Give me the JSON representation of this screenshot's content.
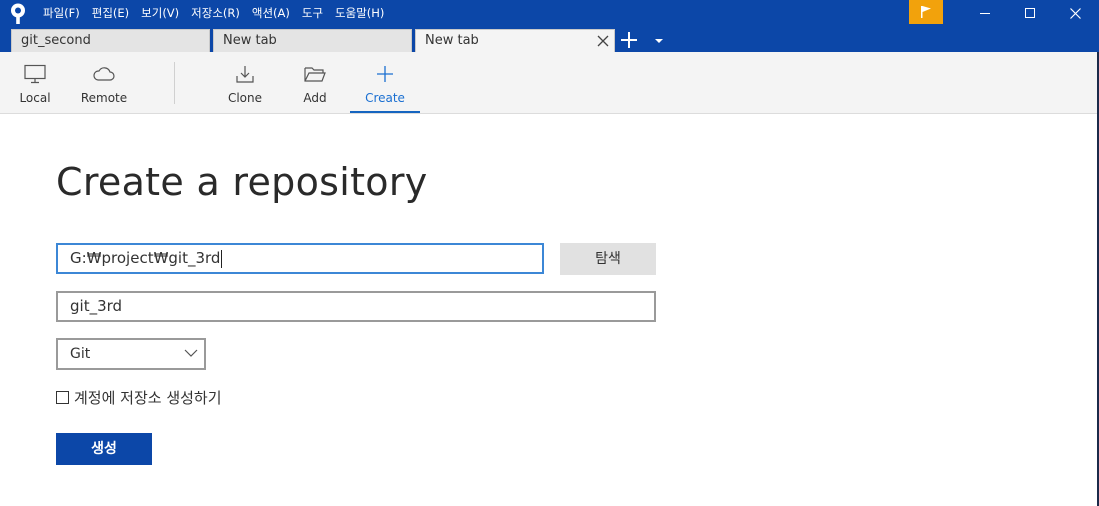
{
  "app": {
    "menu": [
      "파일(F)",
      "편집(E)",
      "보기(V)",
      "저장소(R)",
      "액션(A)",
      "도구",
      "도움말(H)"
    ],
    "colors": {
      "titlebar": "#0c47a8",
      "accent": "#1565c0",
      "flag": "#f2a20c"
    },
    "icons": {
      "logo": "sourcetree-logo-icon",
      "flag": "flag-icon",
      "minimize": "minimize-icon",
      "maximize": "maximize-icon",
      "close": "close-icon"
    }
  },
  "tabs": [
    {
      "label": "git_second",
      "active": false
    },
    {
      "label": "New tab",
      "active": false
    },
    {
      "label": "New tab",
      "active": true
    }
  ],
  "toolbar": {
    "local": "Local",
    "remote": "Remote",
    "clone": "Clone",
    "add": "Add",
    "create": "Create",
    "active": "Create"
  },
  "form": {
    "title": "Create a repository",
    "path_value": "G:₩project₩git_3rd",
    "browse_label": "탐색",
    "name_value": "git_3rd",
    "vcs_selected": "Git",
    "account_checkbox_label": "계정에 저장소 생성하기",
    "account_checkbox_checked": false,
    "create_label": "생성"
  }
}
